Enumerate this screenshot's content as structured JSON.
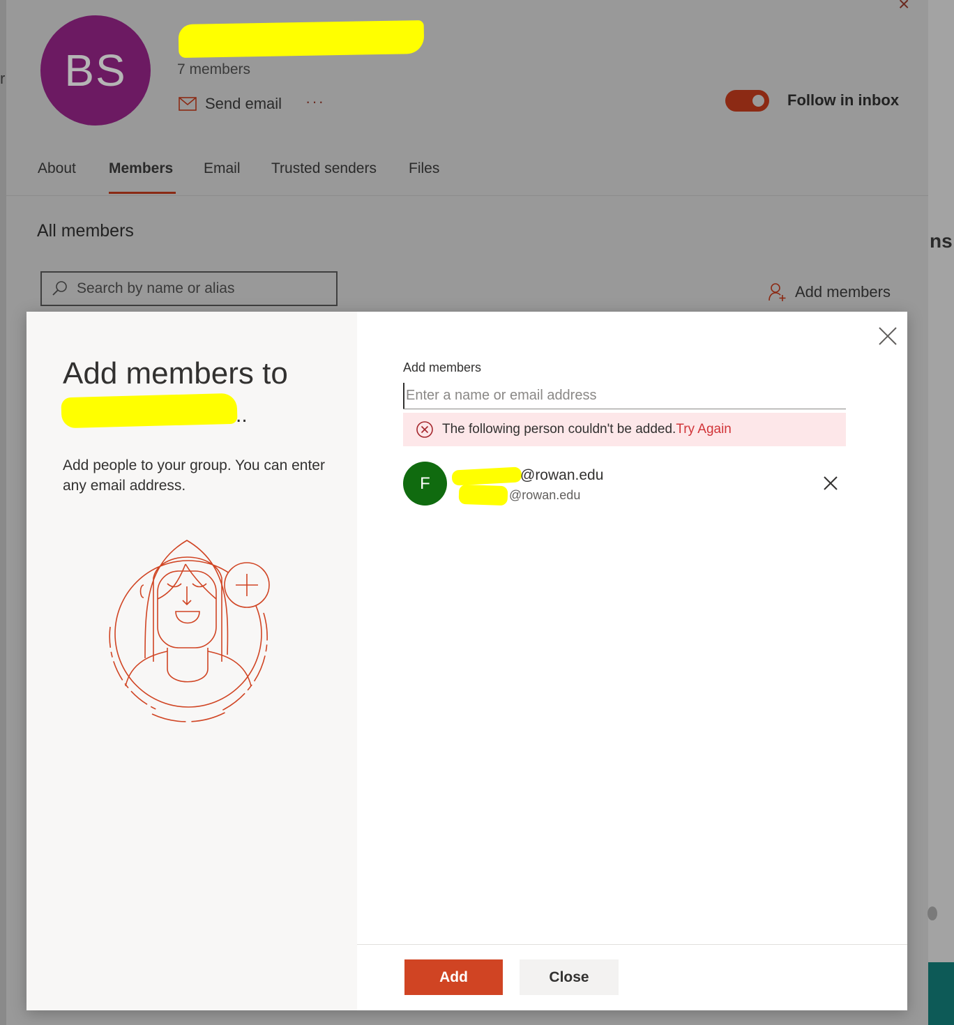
{
  "background": {
    "group": {
      "avatar_initials": "BS",
      "member_count": "7 members",
      "send_email_label": "Send email",
      "more_label": "···",
      "follow_label": "Follow in inbox"
    },
    "tabs": [
      {
        "label": "About"
      },
      {
        "label": "Members"
      },
      {
        "label": "Email"
      },
      {
        "label": "Trusted senders"
      },
      {
        "label": "Files"
      }
    ],
    "section_title": "All members",
    "search_placeholder": "Search by name or alias",
    "add_members_label": "Add members",
    "right_clip_text": "ns",
    "left_clip_text": "r"
  },
  "dialog": {
    "title": "Add members to",
    "title_ellipsis": "..",
    "description": "Add people to your group. You can enter any email address.",
    "field_label": "Add members",
    "input_placeholder": "Enter a name or email address",
    "error_text": "The following person couldn't be added.",
    "error_action": "Try Again",
    "person": {
      "initial": "F",
      "primary": "@rowan.edu",
      "secondary": "@rowan.edu"
    },
    "add_button": "Add",
    "close_button": "Close"
  },
  "colors": {
    "accent": "#d04423",
    "group_avatar": "#6c1a62",
    "person_avatar": "#106b0f",
    "error_bg": "#fde7e9",
    "error_text": "#d13438",
    "redaction": "#ffff00"
  }
}
